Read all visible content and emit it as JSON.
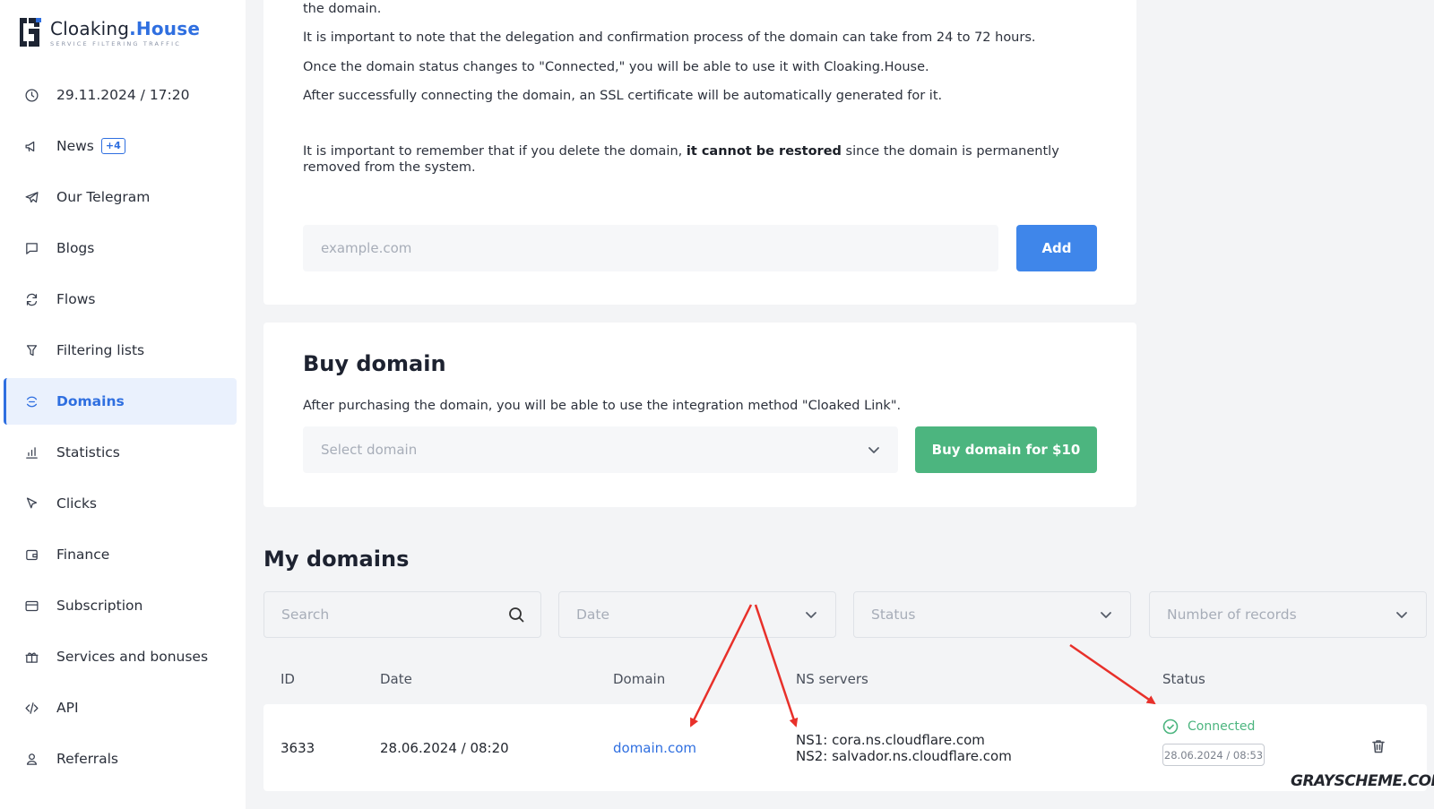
{
  "sidebar": {
    "logo": {
      "name": "Cloaking",
      "accent": ".House",
      "tagline": "SERVICE FILTERING TRAFFIC"
    },
    "datetime": "29.11.2024 / 17:20",
    "items": [
      {
        "label": "News",
        "icon": "megaphone-icon",
        "badge": "+4"
      },
      {
        "label": "Our Telegram",
        "icon": "telegram-icon"
      },
      {
        "label": "Blogs",
        "icon": "chat-bubble-icon"
      },
      {
        "label": "Flows",
        "icon": "refresh-icon"
      },
      {
        "label": "Filtering lists",
        "icon": "filter-icon"
      },
      {
        "label": "Domains",
        "icon": "domain-icon",
        "active": true
      },
      {
        "label": "Statistics",
        "icon": "bar-chart-icon"
      },
      {
        "label": "Clicks",
        "icon": "cursor-icon"
      },
      {
        "label": "Finance",
        "icon": "wallet-icon"
      },
      {
        "label": "Subscription",
        "icon": "card-icon"
      },
      {
        "label": "Services and bonuses",
        "icon": "gift-icon"
      },
      {
        "label": "API",
        "icon": "code-icon"
      },
      {
        "label": "Referrals",
        "icon": "user-icon"
      }
    ]
  },
  "add_domain": {
    "text_ns": "NS record settings can be set in the control panel of the domain name registrar, on the website where you purchased the domain.",
    "text_delegation": "It is important to note that the delegation and confirmation process of the domain can take from 24 to 72 hours.",
    "text_connected": "Once the domain status changes to \"Connected,\" you will be able to use it with Cloaking.House.",
    "text_ssl": "After successfully connecting the domain, an SSL certificate will be automatically generated for it.",
    "text_delete_pre": "It is important to remember that if you delete the domain, ",
    "text_delete_bold": "it cannot be restored",
    "text_delete_post": " since the domain is permanently removed from the system.",
    "input_placeholder": "example.com",
    "add_label": "Add"
  },
  "buy_domain": {
    "title": "Buy domain",
    "description": "After purchasing the domain, you will be able to use the integration method \"Cloaked Link\".",
    "select_placeholder": "Select domain",
    "buy_label": "Buy domain for $10"
  },
  "my_domains": {
    "title": "My domains",
    "filters": {
      "search": "Search",
      "date": "Date",
      "status": "Status",
      "records": "Number of records"
    },
    "columns": {
      "id": "ID",
      "date": "Date",
      "domain": "Domain",
      "ns": "NS servers",
      "status": "Status"
    },
    "rows": [
      {
        "id": "3633",
        "date": "28.06.2024 / 08:20",
        "domain": "domain.com",
        "ns1": "NS1: cora.ns.cloudflare.com",
        "ns2": "NS2: salvador.ns.cloudflare.com",
        "status": "Connected",
        "status_date": "28.06.2024 / 08:53"
      }
    ]
  },
  "watermark": "GRAYSCHEME.COM",
  "colors": {
    "accent": "#2f6fe0",
    "add_button": "#3f86ea",
    "buy_button": "#4cb57f",
    "connected": "#4cb57f",
    "annotation_arrow": "#e8302a"
  }
}
